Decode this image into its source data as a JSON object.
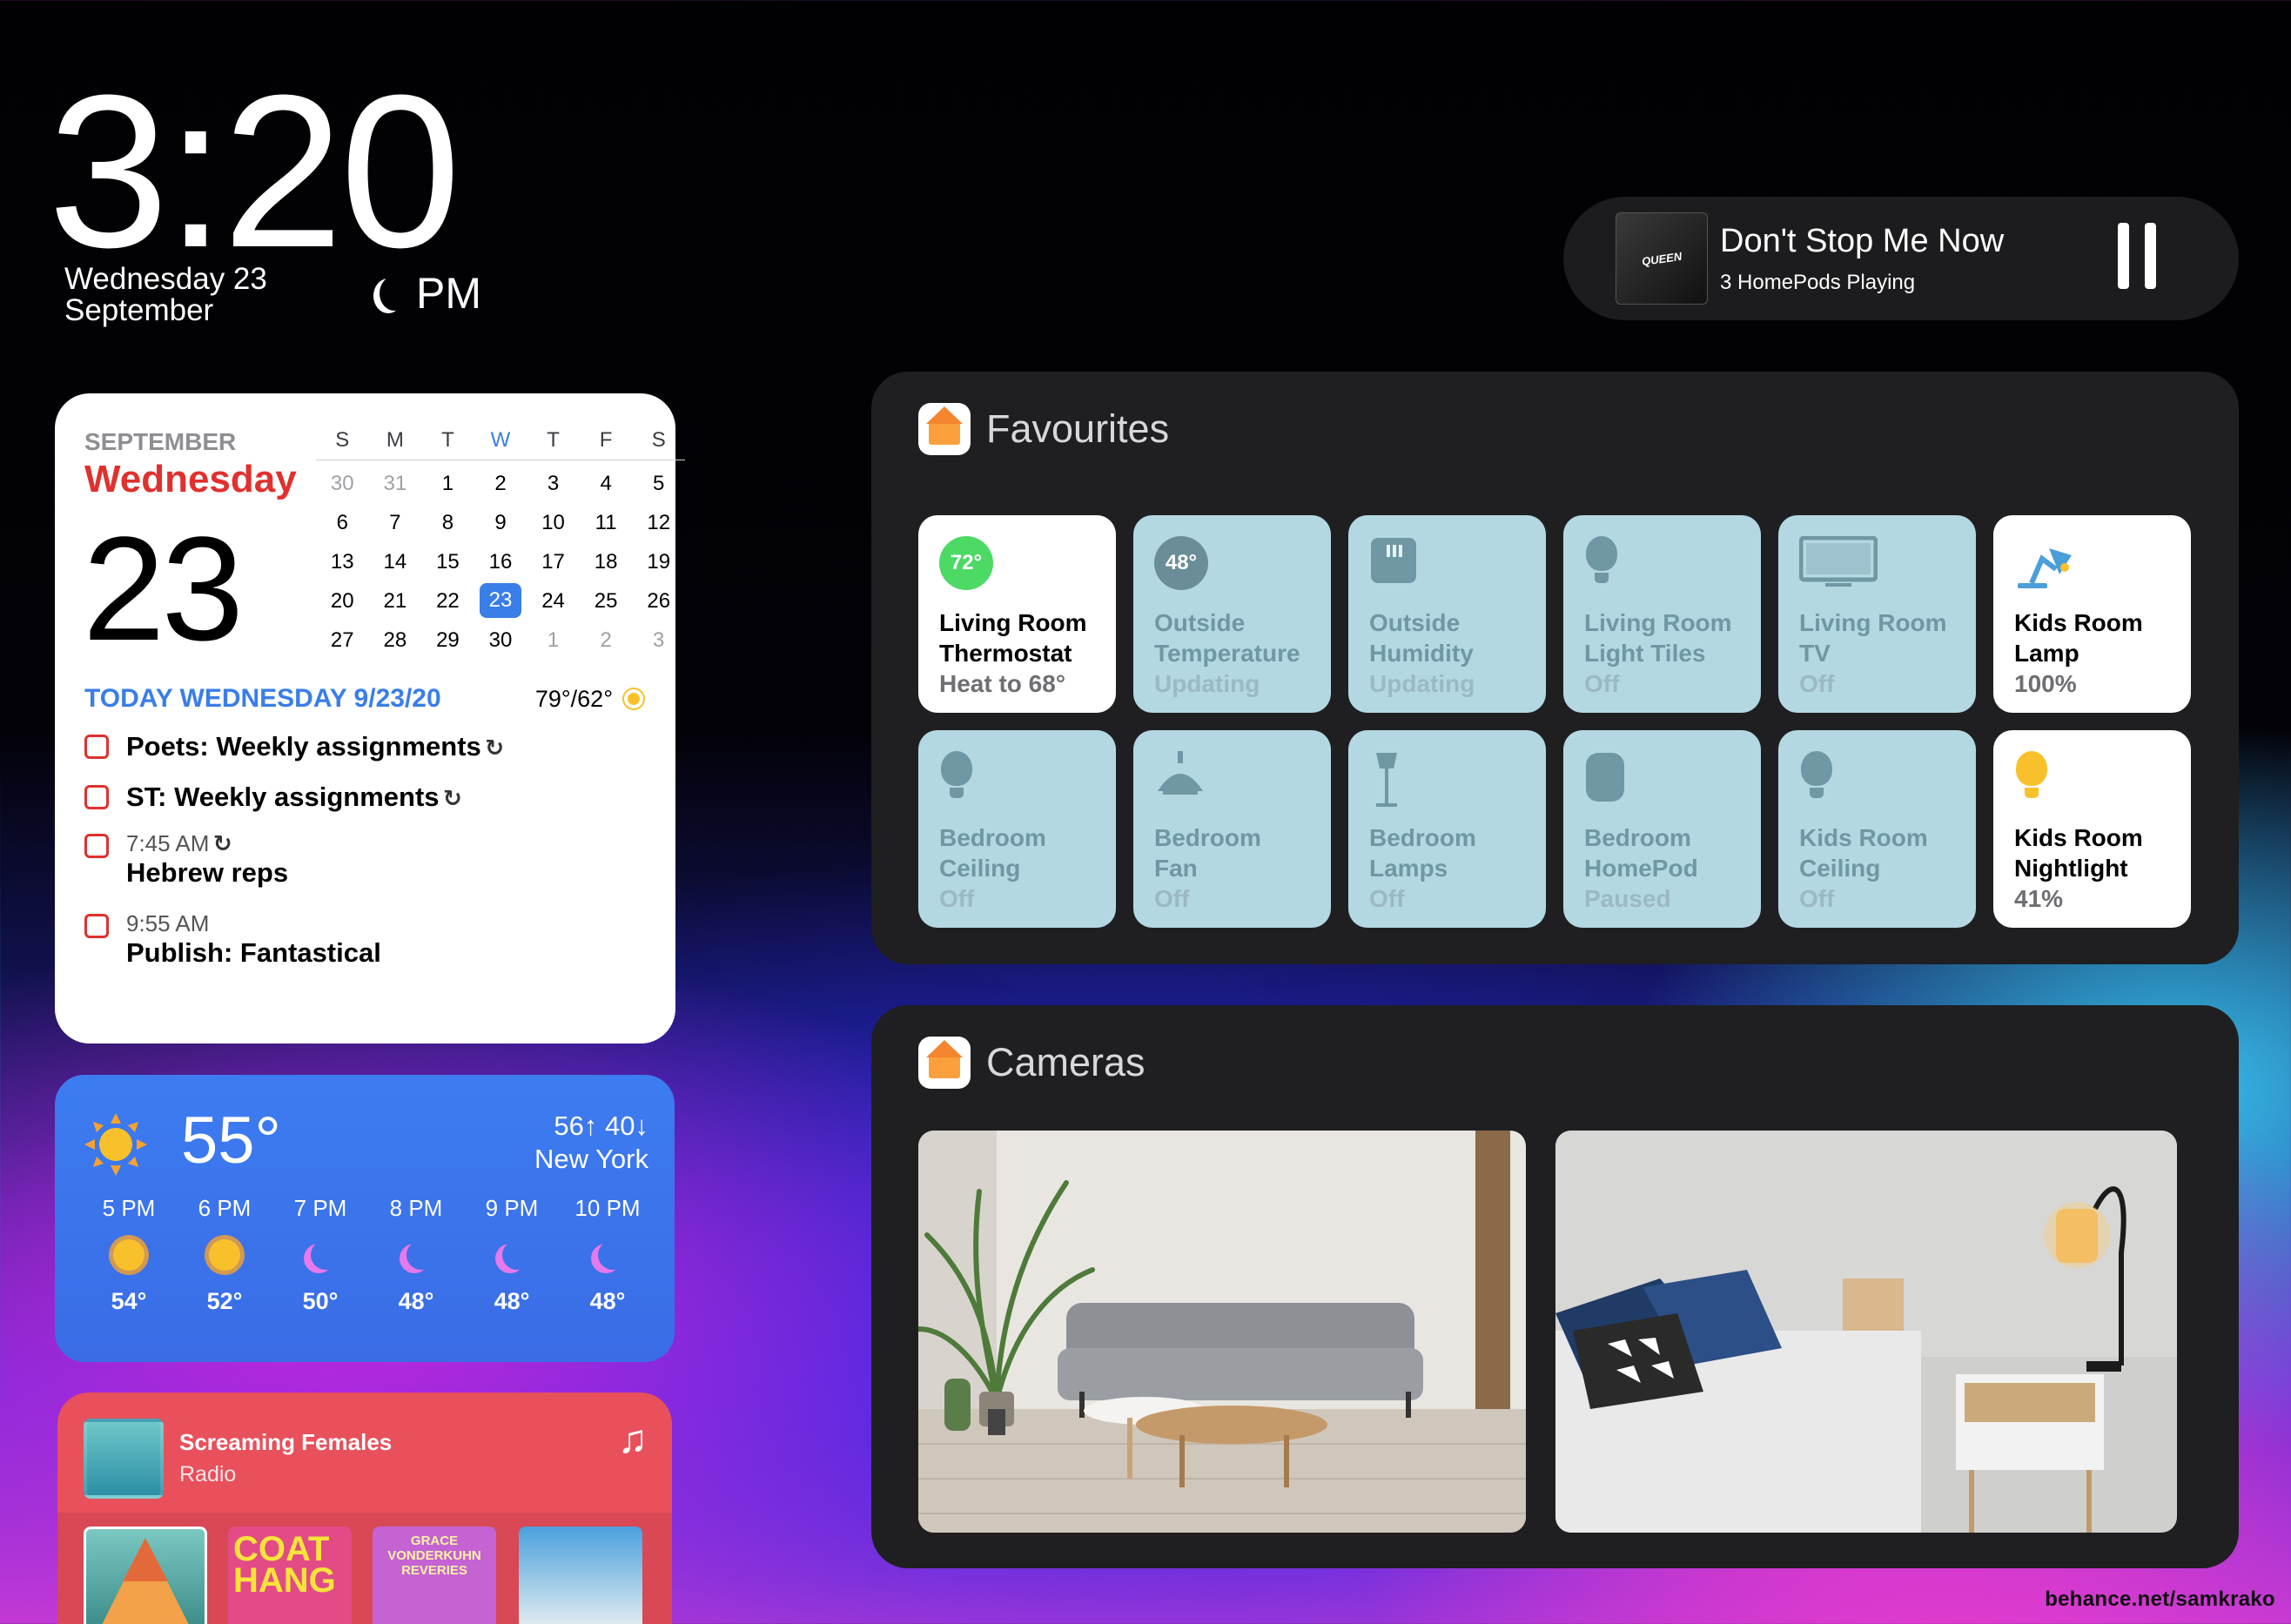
{
  "lock": {
    "time": "3:20",
    "date_line1": "Wednesday 23",
    "date_line2": "September",
    "ampm": "PM"
  },
  "now_playing": {
    "title": "Don't Stop Me Now",
    "subtitle": "3 HomePods Playing",
    "art_text": "QUEEN"
  },
  "calendar": {
    "month": "SEPTEMBER",
    "weekday": "Wednesday",
    "day": "23",
    "week_headers": [
      "S",
      "M",
      "T",
      "W",
      "T",
      "F",
      "S"
    ],
    "weeks": [
      [
        "30",
        "31",
        "1",
        "2",
        "3",
        "4",
        "5"
      ],
      [
        "6",
        "7",
        "8",
        "9",
        "10",
        "11",
        "12"
      ],
      [
        "13",
        "14",
        "15",
        "16",
        "17",
        "18",
        "19"
      ],
      [
        "20",
        "21",
        "22",
        "23",
        "24",
        "25",
        "26"
      ],
      [
        "27",
        "28",
        "29",
        "30",
        "1",
        "2",
        "3"
      ]
    ],
    "today_label": "TODAY WEDNESDAY 9/23/20",
    "forecast": "79°/62°",
    "events": [
      {
        "time": "",
        "title": "Poets: Weekly assignments"
      },
      {
        "time": "",
        "title": "ST: Weekly assignments"
      },
      {
        "time": "7:45 AM",
        "title": "Hebrew reps"
      },
      {
        "time": "9:55 AM",
        "title": "Publish: Fantastical"
      }
    ],
    "repeat_glyph": "↻"
  },
  "weather": {
    "temp": "55°",
    "high_low": "56↑ 40↓",
    "city": "New York",
    "hours": [
      {
        "time": "5 PM",
        "icon": "sun-icon",
        "temp": "54°"
      },
      {
        "time": "6 PM",
        "icon": "sun-icon",
        "temp": "52°"
      },
      {
        "time": "7 PM",
        "icon": "moon-icon",
        "temp": "50°"
      },
      {
        "time": "8 PM",
        "icon": "moon-icon",
        "temp": "48°"
      },
      {
        "time": "9 PM",
        "icon": "moon-icon",
        "temp": "48°"
      },
      {
        "time": "10 PM",
        "icon": "moon-icon",
        "temp": "48°"
      }
    ]
  },
  "music": {
    "title": "Screaming Females",
    "subtitle": "Radio",
    "note_glyph": "♫",
    "album_art_text": [
      "COAT HANG",
      "GRACE VONDERKUHN REVERIES"
    ]
  },
  "favourites": {
    "title": "Favourites",
    "tiles": [
      {
        "name1": "Living Room",
        "name2": "Thermostat",
        "status": "Heat to 68°",
        "on": true,
        "badge": "72°",
        "icon": "thermostat-icon"
      },
      {
        "name1": "Outside",
        "name2": "Temperature",
        "status": "Updating",
        "on": false,
        "badge": "48°",
        "icon": "temperature-sensor-icon"
      },
      {
        "name1": "Outside",
        "name2": "Humidity",
        "status": "Updating",
        "on": false,
        "badge": "",
        "icon": "humidity-sensor-icon"
      },
      {
        "name1": "Living Room",
        "name2": "Light Tiles",
        "status": "Off",
        "on": false,
        "badge": "",
        "icon": "bulb-icon"
      },
      {
        "name1": "Living Room",
        "name2": "TV",
        "status": "Off",
        "on": false,
        "badge": "",
        "icon": "tv-icon"
      },
      {
        "name1": "Kids Room",
        "name2": "Lamp",
        "status": "100%",
        "on": true,
        "badge": "",
        "icon": "desk-lamp-icon"
      },
      {
        "name1": "Bedroom",
        "name2": "Ceiling",
        "status": "Off",
        "on": false,
        "badge": "",
        "icon": "bulb-icon"
      },
      {
        "name1": "Bedroom",
        "name2": "Fan",
        "status": "Off",
        "on": false,
        "badge": "",
        "icon": "pendant-fan-icon"
      },
      {
        "name1": "Bedroom",
        "name2": "Lamps",
        "status": "Off",
        "on": false,
        "badge": "",
        "icon": "floor-lamp-icon"
      },
      {
        "name1": "Bedroom",
        "name2": "HomePod",
        "status": "Paused",
        "on": false,
        "badge": "",
        "icon": "homepod-icon"
      },
      {
        "name1": "Kids Room",
        "name2": "Ceiling",
        "status": "Off",
        "on": false,
        "badge": "",
        "icon": "bulb-icon"
      },
      {
        "name1": "Kids Room",
        "name2": "Nightlight",
        "status": "41%",
        "on": true,
        "badge": "",
        "icon": "bulb-icon"
      }
    ]
  },
  "cameras": {
    "title": "Cameras",
    "feeds": [
      "living-room-camera",
      "bedroom-camera"
    ]
  },
  "credit": "behance.net/samkrako",
  "colors": {
    "accent_blue": "#3a7ee8",
    "calendar_red": "#e0312e",
    "thermostat_green": "#4cd964",
    "tile_off": "#b4d8e2"
  }
}
